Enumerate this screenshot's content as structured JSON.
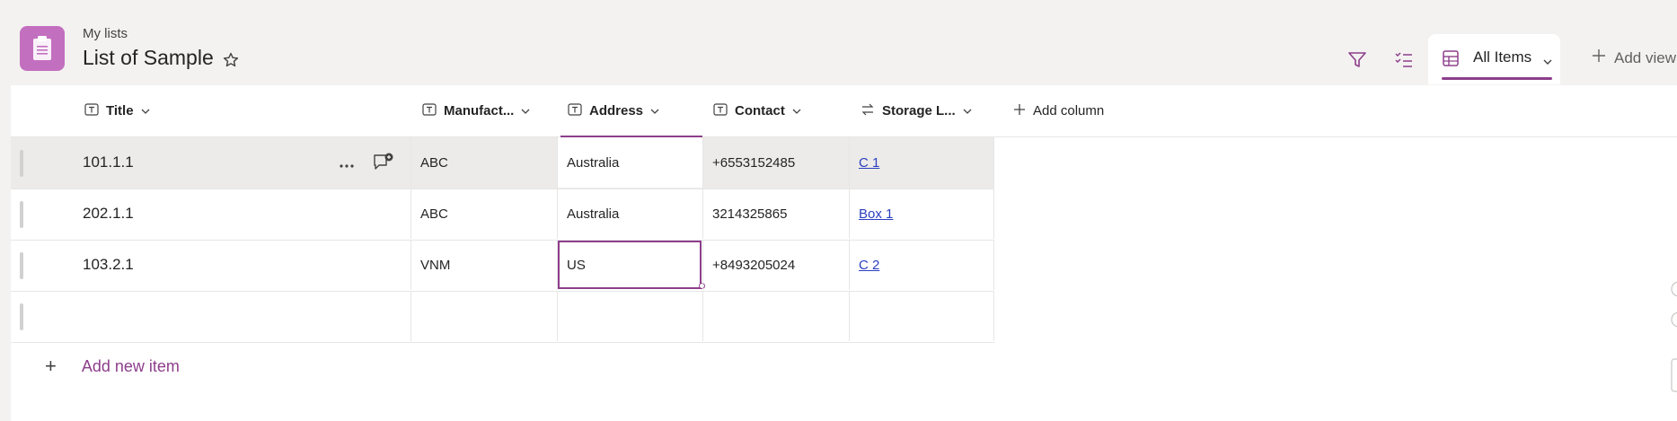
{
  "breadcrumb": "My lists",
  "list_title": "List of Sample",
  "toolbar": {
    "view_name": "All Items",
    "add_view_label": "Add view"
  },
  "columns": [
    {
      "label": "Title",
      "icon": "text-type-icon"
    },
    {
      "label": "Manufact...",
      "icon": "text-type-icon"
    },
    {
      "label": "Address",
      "icon": "text-type-icon"
    },
    {
      "label": "Contact",
      "icon": "text-type-icon"
    },
    {
      "label": "Storage L...",
      "icon": "lookup-type-icon"
    }
  ],
  "add_column_label": "Add column",
  "rows": [
    {
      "title": "101.1.1",
      "manufacturer": "ABC",
      "address": "Australia",
      "contact": "+6553152485",
      "storage": "C 1"
    },
    {
      "title": "202.1.1",
      "manufacturer": "ABC",
      "address": "Australia",
      "contact": "3214325865",
      "storage": "Box 1"
    },
    {
      "title": "103.2.1",
      "manufacturer": "VNM",
      "address": "US",
      "contact": "+8493205024",
      "storage": "C 2"
    }
  ],
  "add_new_item_label": "Add new item",
  "colors": {
    "accent": "#8d3e8b",
    "app_icon": "#c36fbf",
    "link": "#2a3fbf"
  }
}
